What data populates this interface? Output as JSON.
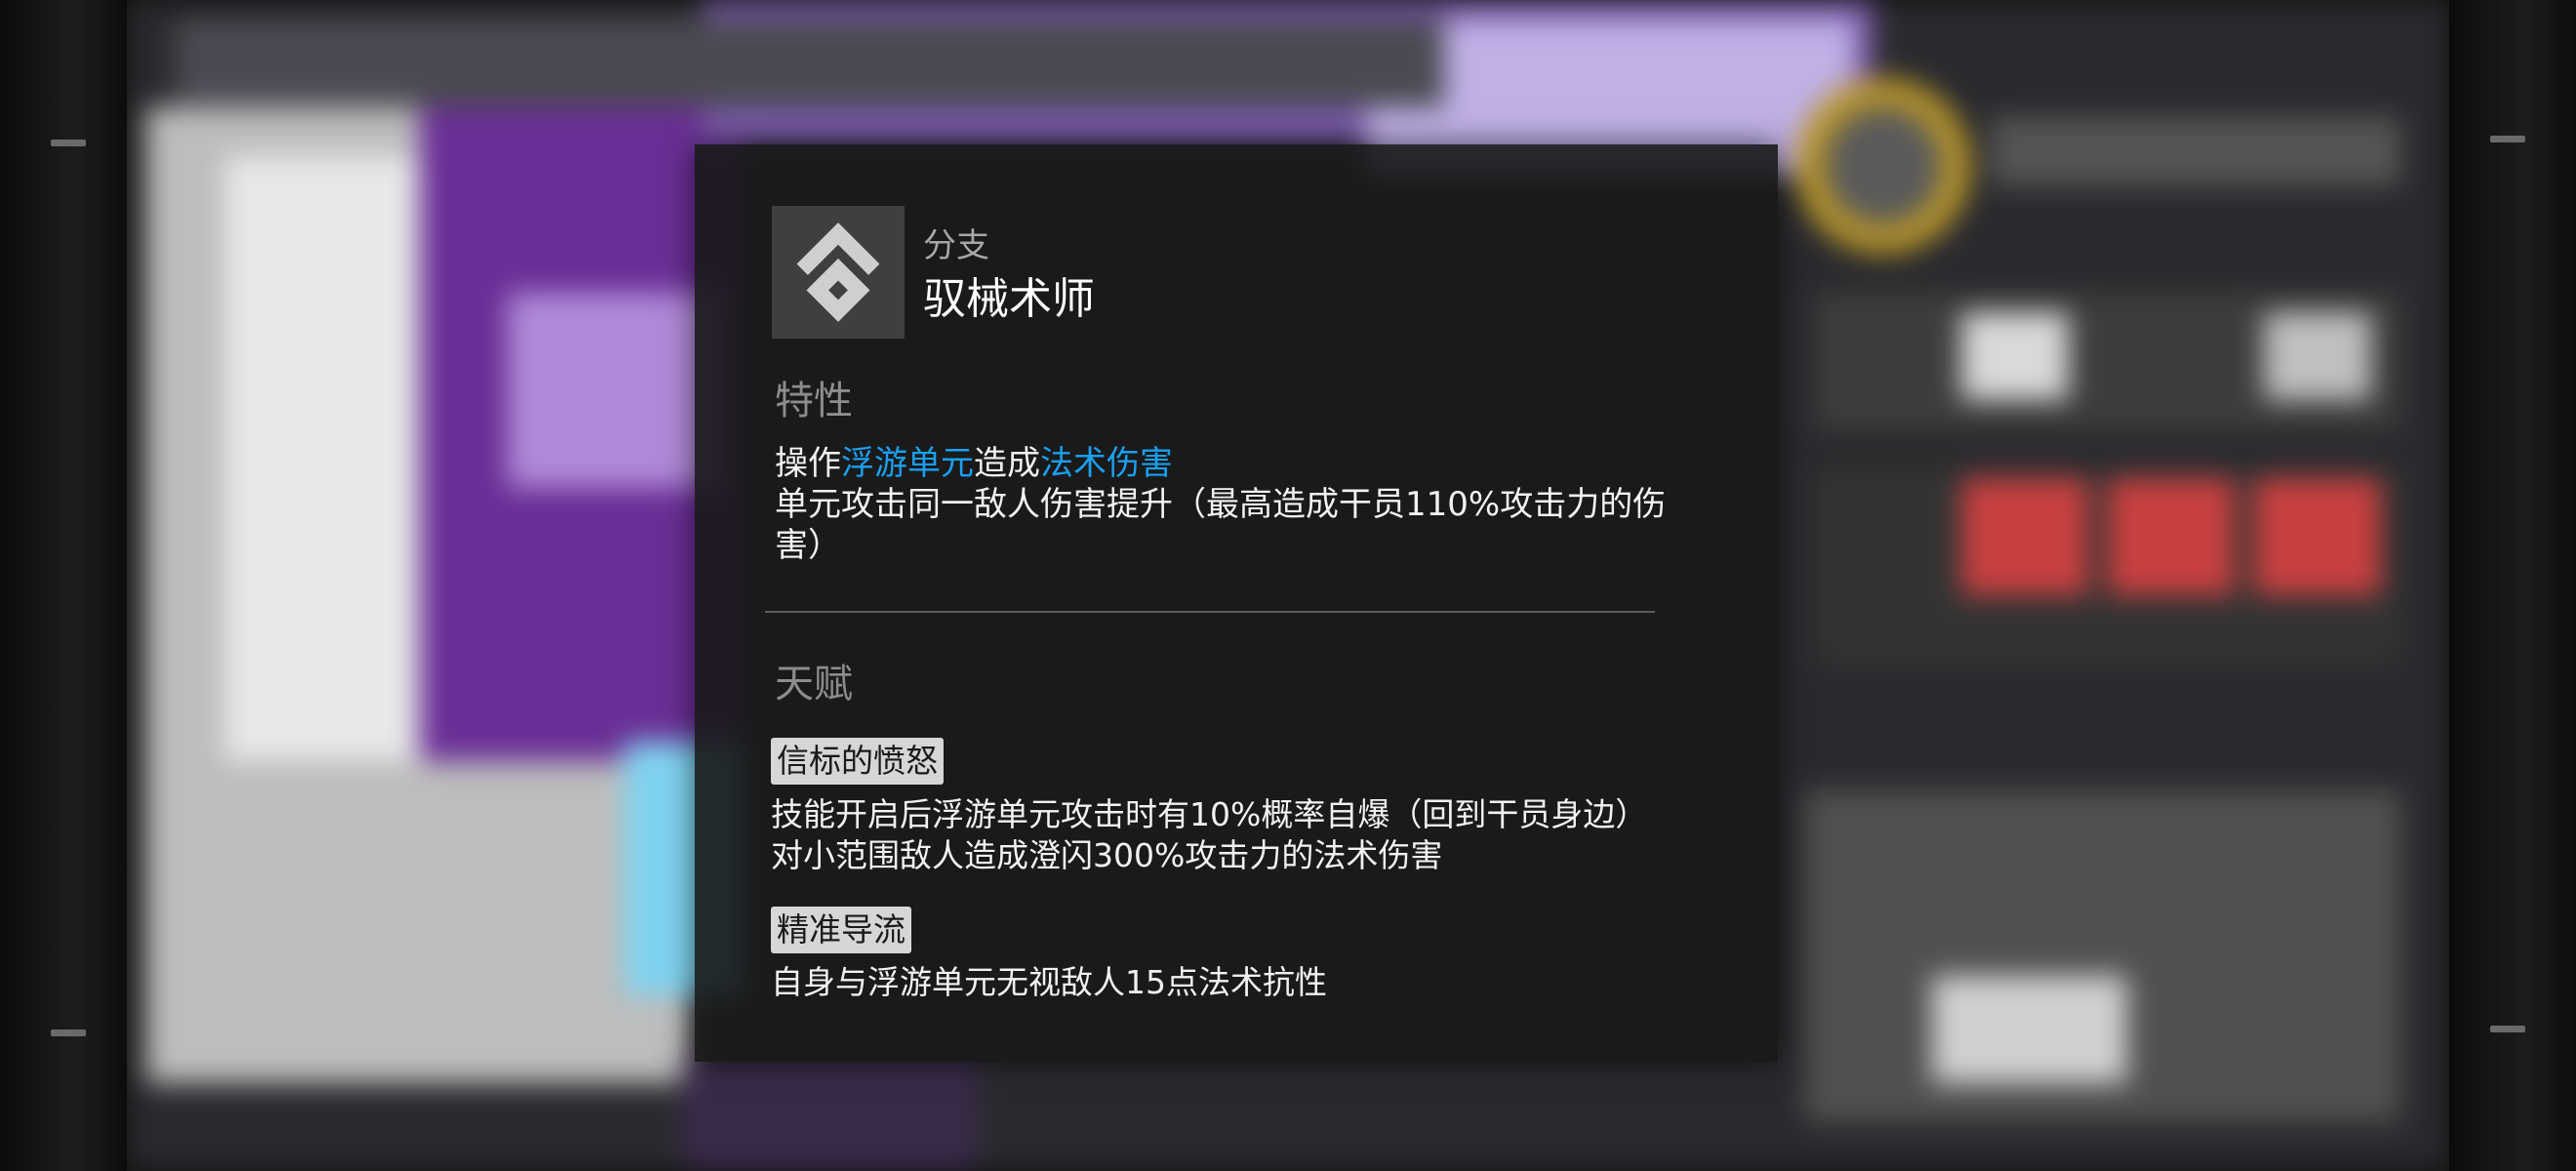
{
  "branch": {
    "caption": "分支",
    "name": "驭械术师",
    "icon": "mechaccord-branch-icon"
  },
  "trait": {
    "title": "特性",
    "line1_prefix": "操作",
    "line1_hl1": "浮游单元",
    "line1_mid": "造成",
    "line1_hl2": "法术伤害",
    "line2": "单元攻击同一敌人伤害提升（最高造成干员110%攻击力的伤害）"
  },
  "talents": {
    "title": "天赋",
    "items": [
      {
        "name": "信标的愤怒",
        "desc_line1": "技能开启后浮游单元攻击时有10%概率自爆（回到干员身边）",
        "desc_line2": "对小范围敌人造成澄闪300%攻击力的法术伤害"
      },
      {
        "name": "精准导流",
        "desc_line1": "自身与浮游单元无视敌人15点法术抗性",
        "desc_line2": ""
      }
    ]
  },
  "colors": {
    "highlight": "#1aa0f0",
    "panel_bg": "#181818",
    "tag_bg": "#d6d6d6"
  }
}
